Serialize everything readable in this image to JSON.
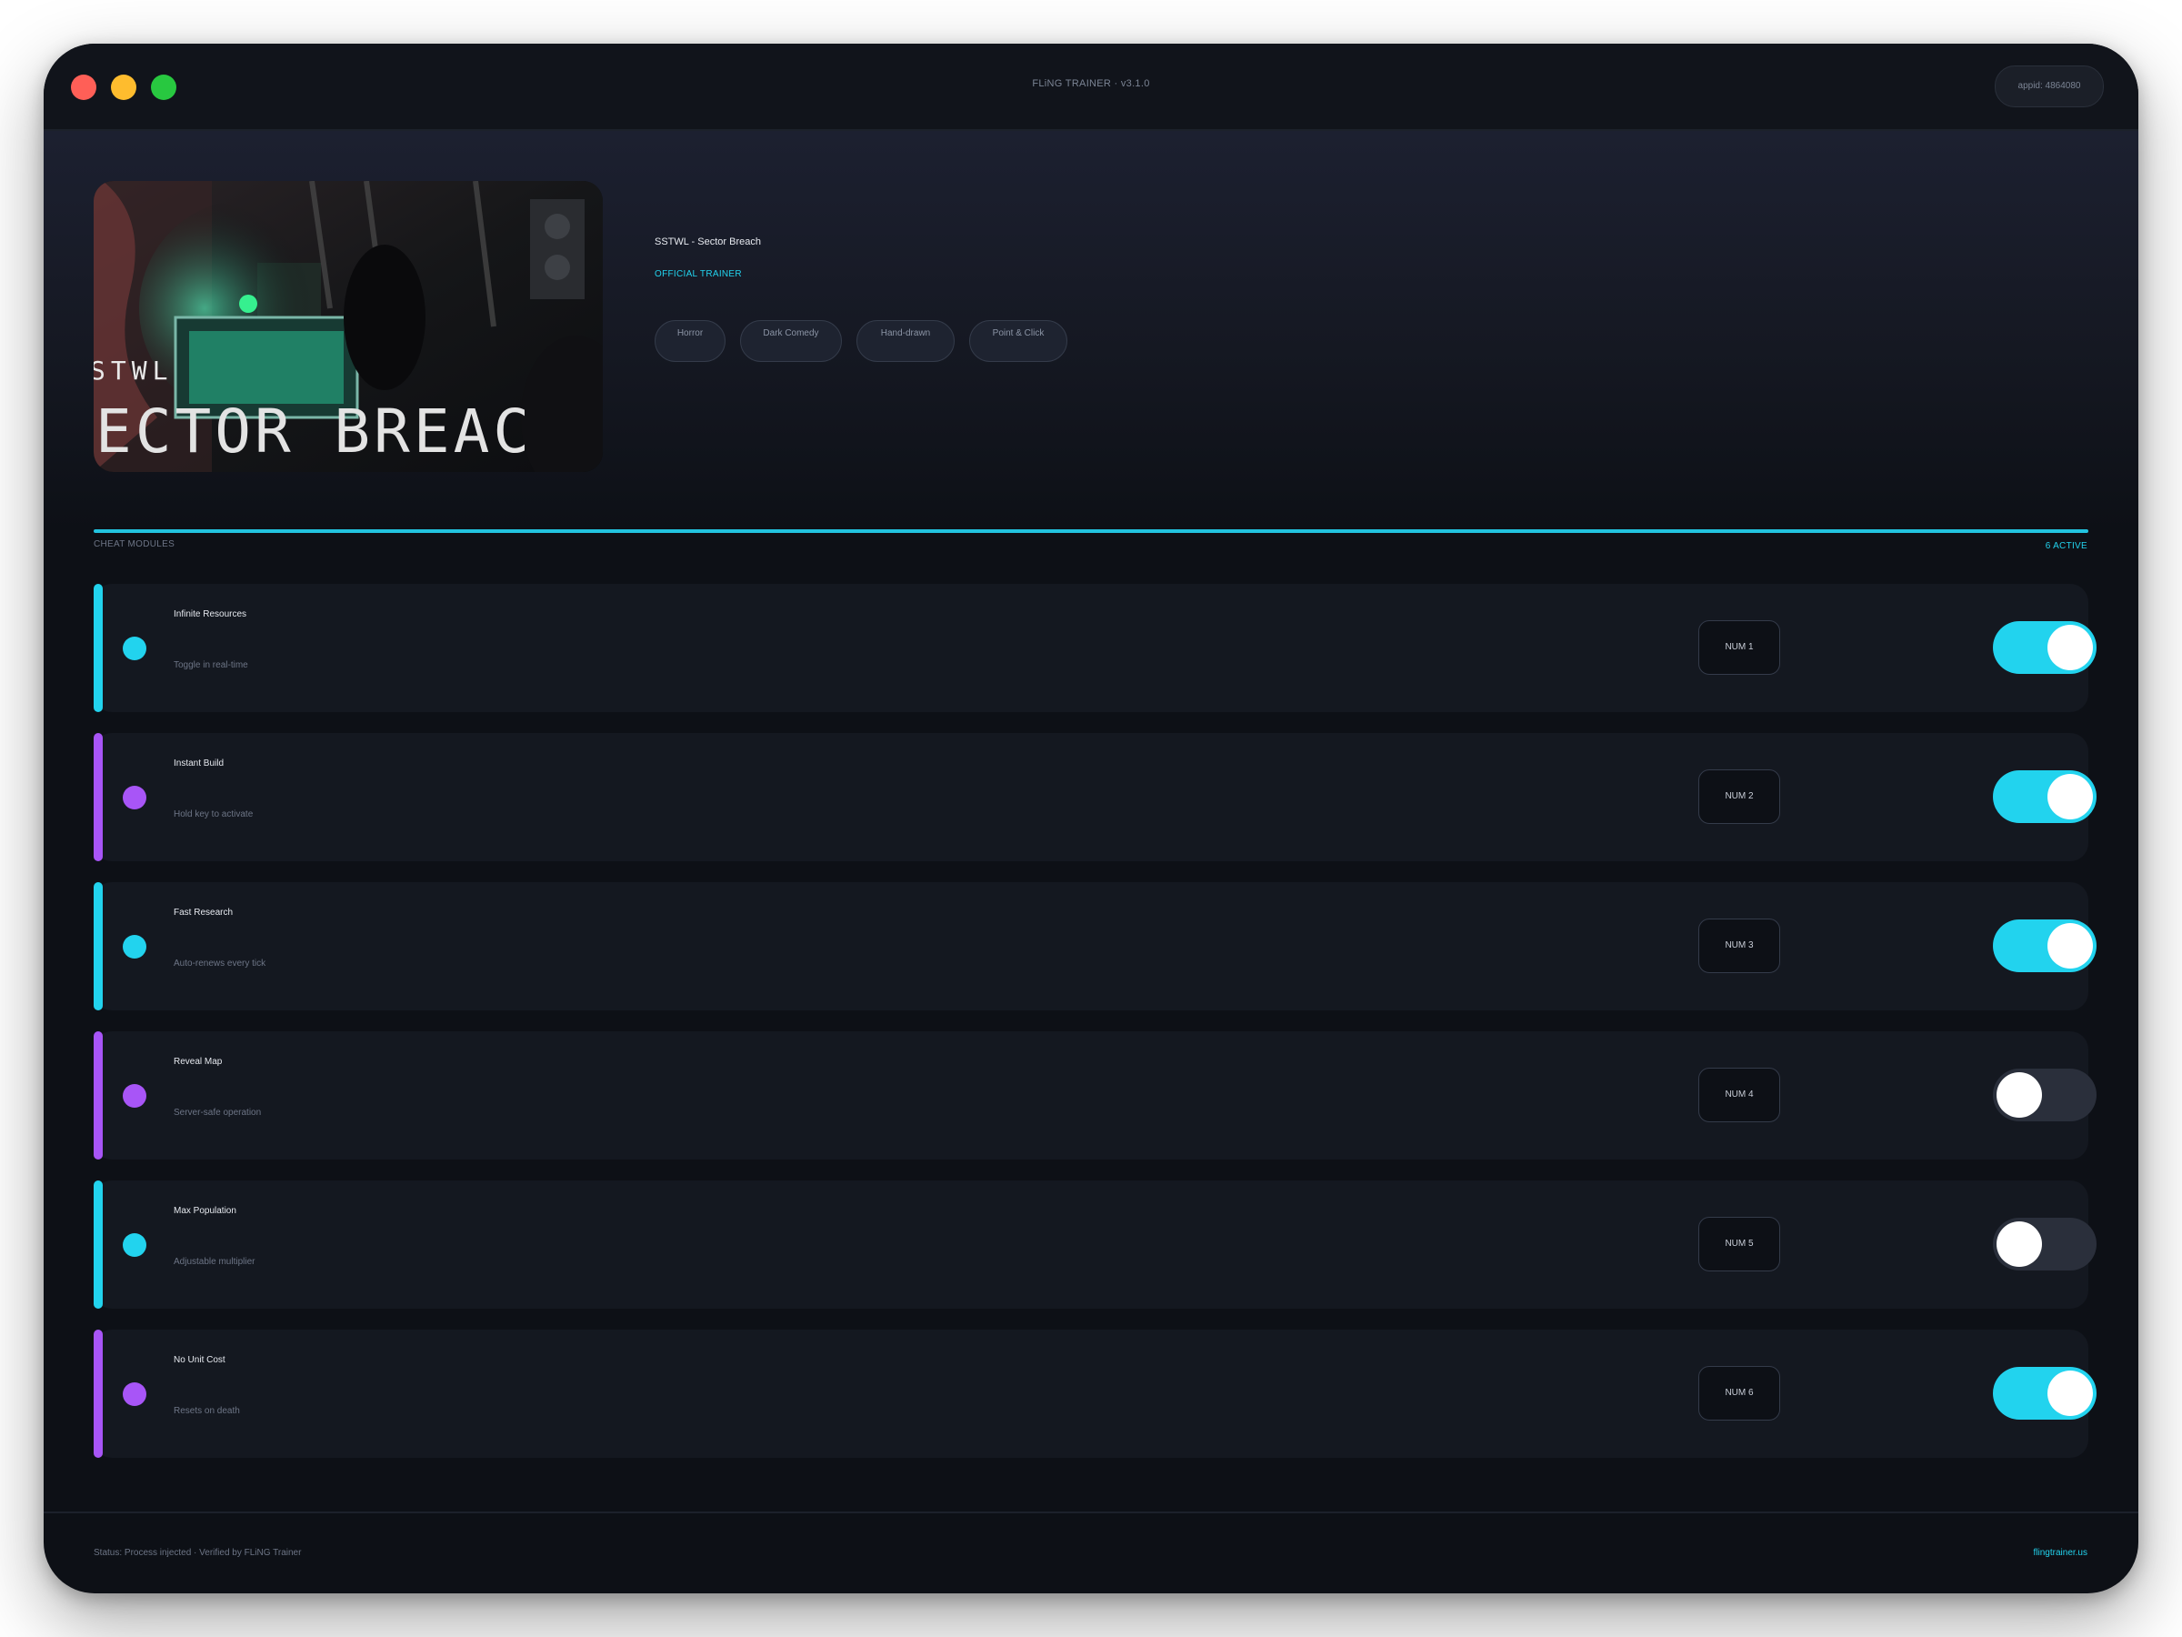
{
  "window": {
    "title": "FLiNG TRAINER · v3.1.0",
    "appid": "appid: 4864080"
  },
  "game": {
    "title": "SSTWL - Sector Breach",
    "badge": "OFFICIAL TRAINER",
    "tags": [
      "Horror",
      "Dark Comedy",
      "Hand-drawn",
      "Point & Click"
    ],
    "cover_text_top": "STWL",
    "cover_text_main": "ECTOR BREAC"
  },
  "section": {
    "label": "CHEAT MODULES",
    "active": "6 ACTIVE"
  },
  "colors": {
    "accent": "#22d3ee",
    "purple": "#a855f7",
    "toggle_off": "#2a2f3b"
  },
  "cheats": [
    {
      "name": "Infinite Resources",
      "desc": "Toggle in real-time",
      "key": "NUM 1",
      "enabled": true,
      "accent": "cyan"
    },
    {
      "name": "Instant Build",
      "desc": "Hold key to activate",
      "key": "NUM 2",
      "enabled": true,
      "accent": "purple"
    },
    {
      "name": "Fast Research",
      "desc": "Auto-renews every tick",
      "key": "NUM 3",
      "enabled": true,
      "accent": "cyan"
    },
    {
      "name": "Reveal Map",
      "desc": "Server-safe operation",
      "key": "NUM 4",
      "enabled": false,
      "accent": "purple"
    },
    {
      "name": "Max Population",
      "desc": "Adjustable multiplier",
      "key": "NUM 5",
      "enabled": false,
      "accent": "cyan"
    },
    {
      "name": "No Unit Cost",
      "desc": "Resets on death",
      "key": "NUM 6",
      "enabled": true,
      "accent": "purple"
    }
  ],
  "footer": {
    "status": "Status: Process injected · Verified by FLiNG Trainer",
    "link": "flingtrainer.us"
  }
}
